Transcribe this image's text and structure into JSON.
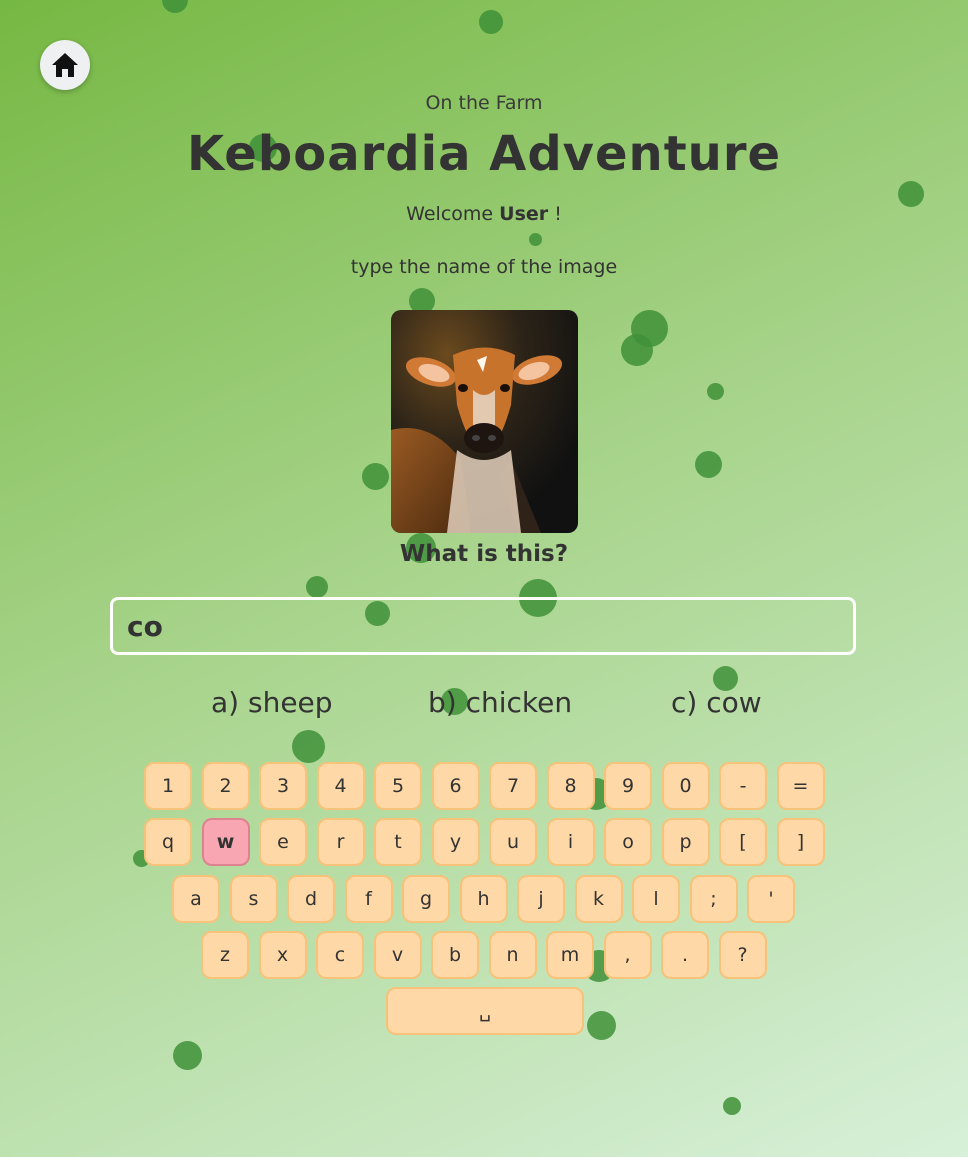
{
  "header": {
    "home_icon": "home-icon",
    "subtitle": "On the Farm",
    "title": "Keboardia Adventure",
    "welcome_prefix": "Welcome",
    "username": "User",
    "welcome_suffix": "!"
  },
  "game": {
    "instruction": "type the name of the image",
    "question": "What is this?",
    "input_value": "co",
    "options": [
      "a) sheep",
      "b) chicken",
      "c) cow"
    ]
  },
  "keyboard": {
    "rows": [
      [
        "1",
        "2",
        "3",
        "4",
        "5",
        "6",
        "7",
        "8",
        "9",
        "0",
        "-",
        "="
      ],
      [
        "q",
        "w",
        "e",
        "r",
        "t",
        "y",
        "u",
        "i",
        "o",
        "p",
        "[",
        "]"
      ],
      [
        "a",
        "s",
        "d",
        "f",
        "g",
        "h",
        "j",
        "k",
        "l",
        ";",
        "'"
      ],
      [
        "z",
        "x",
        "c",
        "v",
        "b",
        "n",
        "m",
        ",",
        ".",
        "?"
      ]
    ],
    "space_label": "␣",
    "highlighted_key": "w"
  },
  "colors": {
    "key_fill": "#fed8a6",
    "key_border": "#f7c27a",
    "key_active": "#f8a6b1",
    "bubble": "#3f9038"
  }
}
